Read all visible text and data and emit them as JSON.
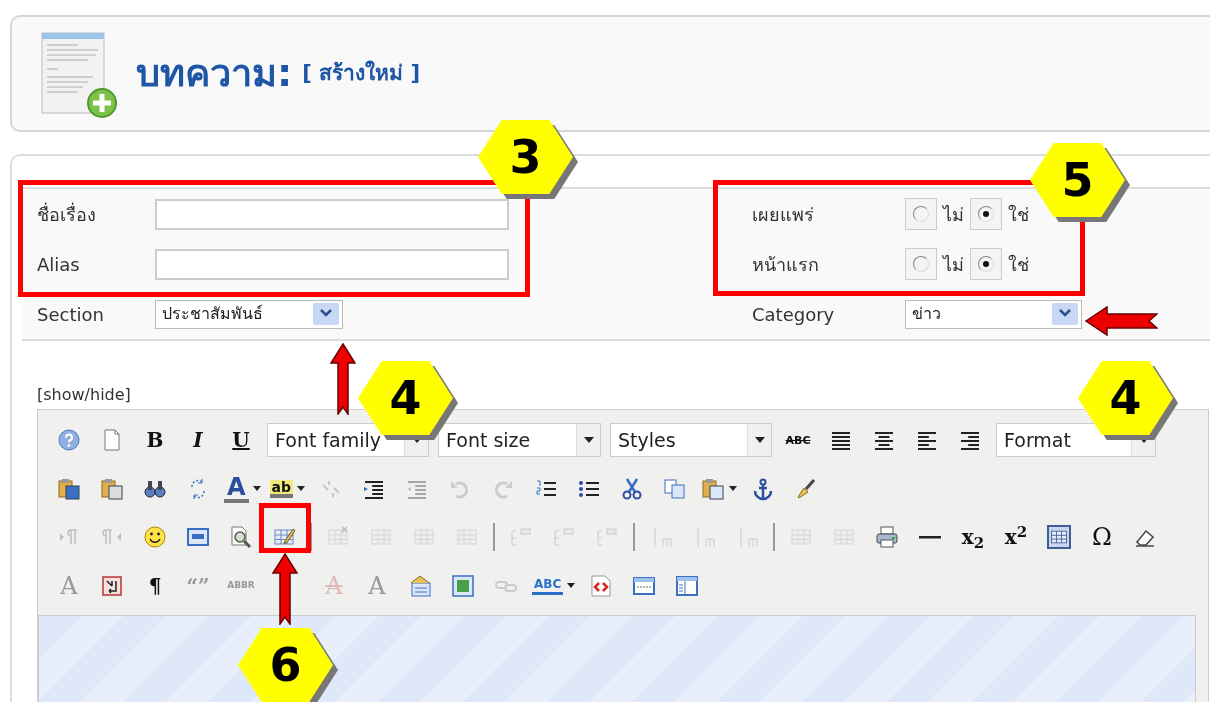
{
  "header": {
    "title": "บทความ:",
    "subtitle": "[ สร้างใหม่ ]"
  },
  "form": {
    "left": [
      {
        "label": "ชื่อเรื่อง",
        "kind": "text"
      },
      {
        "label": "Alias",
        "kind": "text"
      },
      {
        "label": "Section",
        "kind": "select",
        "value": "ประชาสัมพันธ์"
      }
    ],
    "right": [
      {
        "label": "เผยแพร่",
        "kind": "radio",
        "options": [
          {
            "label": "ไม่",
            "selected": false
          },
          {
            "label": "ใช่",
            "selected": true
          }
        ]
      },
      {
        "label": "หน้าแรก",
        "kind": "radio",
        "options": [
          {
            "label": "ไม่",
            "selected": false
          },
          {
            "label": "ใช่",
            "selected": true
          }
        ]
      },
      {
        "label": "Category",
        "kind": "select",
        "value": "ข่าว"
      }
    ]
  },
  "editor": {
    "toggle_link": "[show/hide]",
    "toolbar": [
      [
        {
          "kind": "button",
          "disabled": false,
          "active": false
        },
        {
          "kind": "button",
          "disabled": false,
          "active": false
        },
        {
          "kind": "button",
          "text": "B",
          "disabled": false,
          "active": false
        },
        {
          "kind": "button",
          "text": "I",
          "disabled": false,
          "active": false
        },
        {
          "kind": "button",
          "text": "U",
          "disabled": false,
          "active": false
        },
        {
          "kind": "select",
          "label": "Font family"
        },
        {
          "kind": "select",
          "label": "Font size"
        },
        {
          "kind": "select",
          "label": "Styles"
        },
        {
          "kind": "button",
          "text": "ABC",
          "disabled": false,
          "active": false
        },
        {
          "kind": "button",
          "disabled": false,
          "active": false
        },
        {
          "kind": "button",
          "disabled": false,
          "active": false
        },
        {
          "kind": "button",
          "disabled": false,
          "active": false
        },
        {
          "kind": "button",
          "disabled": false,
          "active": false
        },
        {
          "kind": "select",
          "label": "Format"
        }
      ],
      [
        {
          "kind": "button",
          "disabled": false,
          "active": false
        },
        {
          "kind": "button",
          "disabled": false,
          "active": false
        },
        {
          "kind": "button",
          "disabled": false,
          "active": false
        },
        {
          "kind": "button",
          "disabled": false,
          "active": false
        },
        {
          "kind": "split",
          "text": "A",
          "disabled": false,
          "active": false
        },
        {
          "kind": "split",
          "text": "ab",
          "disabled": false,
          "active": false
        },
        {
          "kind": "button",
          "disabled": true,
          "active": false
        },
        {
          "kind": "button",
          "disabled": false,
          "active": false
        },
        {
          "kind": "button",
          "disabled": true,
          "active": false
        },
        {
          "kind": "button",
          "disabled": true,
          "active": false
        },
        {
          "kind": "button",
          "disabled": true,
          "active": false
        },
        {
          "kind": "button",
          "disabled": false,
          "active": false
        },
        {
          "kind": "button",
          "disabled": false,
          "active": false
        },
        {
          "kind": "button",
          "disabled": false,
          "active": false
        },
        {
          "kind": "button",
          "disabled": false,
          "active": false
        },
        {
          "kind": "split",
          "disabled": false,
          "active": false
        },
        {
          "kind": "button",
          "disabled": false,
          "active": false
        },
        {
          "kind": "button",
          "disabled": false,
          "active": false
        }
      ],
      [
        {
          "kind": "button",
          "disabled": true,
          "active": false
        },
        {
          "kind": "button",
          "disabled": true,
          "active": false
        },
        {
          "kind": "button",
          "disabled": false,
          "active": false
        },
        {
          "kind": "button",
          "disabled": false,
          "active": false
        },
        {
          "kind": "button",
          "disabled": false,
          "active": false
        },
        {
          "kind": "button",
          "disabled": false,
          "active": false
        },
        {
          "kind": "separator"
        },
        {
          "kind": "button",
          "disabled": true,
          "active": false
        },
        {
          "kind": "button",
          "disabled": true,
          "active": false
        },
        {
          "kind": "button",
          "disabled": true,
          "active": false
        },
        {
          "kind": "button",
          "disabled": true,
          "active": false
        },
        {
          "kind": "separator"
        },
        {
          "kind": "button",
          "disabled": true,
          "active": false
        },
        {
          "kind": "button",
          "disabled": true,
          "active": false
        },
        {
          "kind": "button",
          "disabled": true,
          "active": false
        },
        {
          "kind": "separator"
        },
        {
          "kind": "button",
          "disabled": true,
          "active": false
        },
        {
          "kind": "button",
          "disabled": true,
          "active": false
        },
        {
          "kind": "button",
          "disabled": true,
          "active": false
        },
        {
          "kind": "separator"
        },
        {
          "kind": "button",
          "disabled": true,
          "active": false
        },
        {
          "kind": "button",
          "disabled": true,
          "active": false
        },
        {
          "kind": "button",
          "disabled": false,
          "active": false
        },
        {
          "kind": "button",
          "disabled": false,
          "active": false
        },
        {
          "kind": "button",
          "text": "x$_{2}$",
          "disabled": false,
          "active": false
        },
        {
          "kind": "button",
          "text": "x$^{2}$",
          "disabled": false,
          "active": false
        },
        {
          "kind": "button",
          "disabled": false,
          "active": true
        },
        {
          "kind": "button",
          "text": "Ω",
          "disabled": false,
          "active": false
        },
        {
          "kind": "button",
          "disabled": false,
          "active": false
        }
      ],
      [
        {
          "kind": "button",
          "text": "A",
          "disabled": true,
          "active": false
        },
        {
          "kind": "button",
          "disabled": false,
          "active": false
        },
        {
          "kind": "button",
          "text": "¶",
          "disabled": false,
          "active": false
        },
        {
          "kind": "button",
          "text": "“”",
          "disabled": true,
          "active": false
        },
        {
          "kind": "button",
          "text": "ABBR",
          "disabled": true,
          "active": false
        },
        {
          "kind": "button",
          "text": "A",
          "disabled": true,
          "active": false
        },
        {
          "kind": "button",
          "text": "A",
          "disabled": true,
          "active": false
        },
        {
          "kind": "button",
          "disabled": false,
          "active": false
        },
        {
          "kind": "button",
          "disabled": false,
          "active": false
        },
        {
          "kind": "button",
          "disabled": true,
          "active": false
        },
        {
          "kind": "split",
          "text": "ABC",
          "disabled": false,
          "active": false
        },
        {
          "kind": "button",
          "disabled": false,
          "active": false
        },
        {
          "kind": "button",
          "disabled": false,
          "active": false
        },
        {
          "kind": "button",
          "disabled": false,
          "active": false
        }
      ]
    ]
  },
  "callouts": [
    {
      "kind": "badge",
      "text": "3"
    },
    {
      "kind": "frame"
    },
    {
      "kind": "badge",
      "text": "5"
    },
    {
      "kind": "frame"
    },
    {
      "kind": "arrow"
    },
    {
      "kind": "arrow"
    },
    {
      "kind": "badge",
      "text": "4"
    },
    {
      "kind": "badge",
      "text": "4"
    },
    {
      "kind": "frame"
    },
    {
      "kind": "arrow"
    },
    {
      "kind": "badge",
      "text": "6"
    }
  ]
}
